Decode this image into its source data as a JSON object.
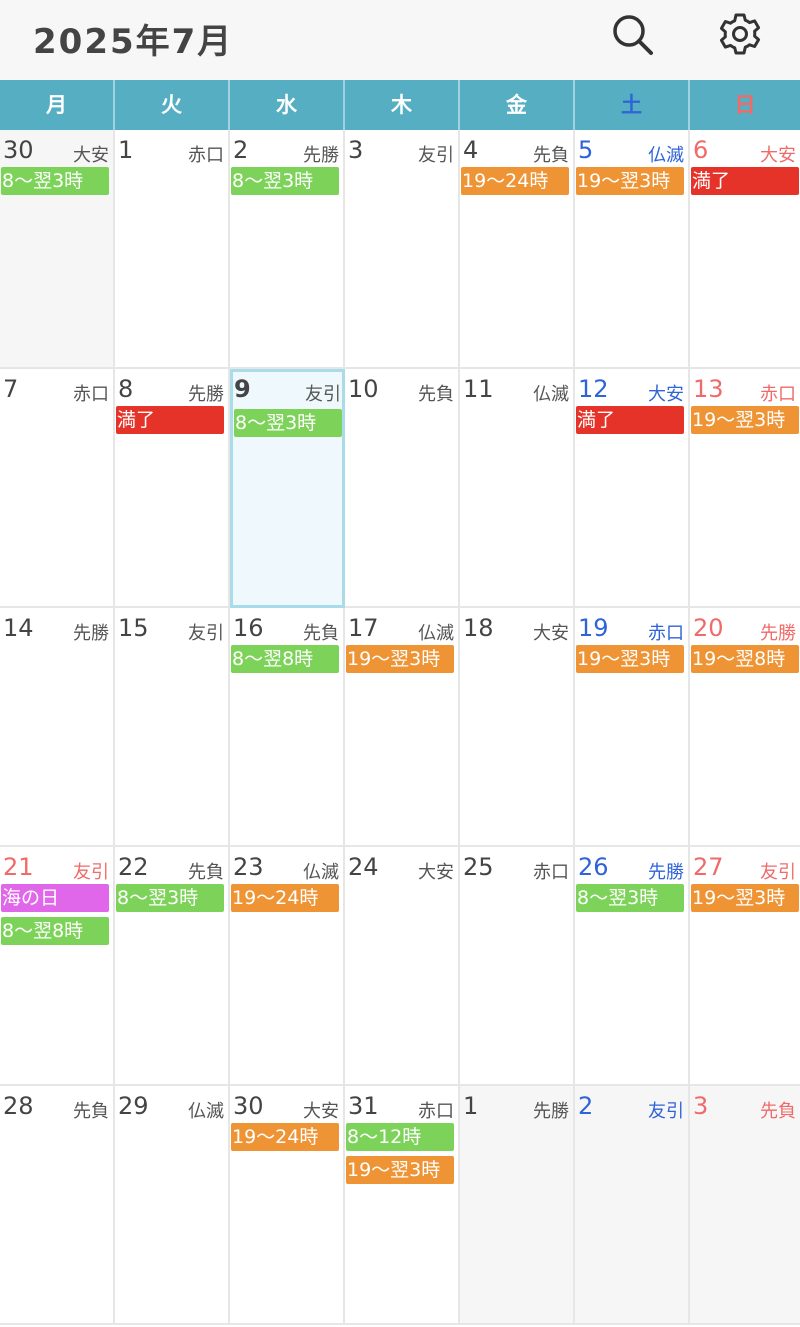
{
  "header": {
    "title": "2025年7月"
  },
  "weekdays": [
    "月",
    "火",
    "水",
    "木",
    "金",
    "土",
    "日"
  ],
  "colors": {
    "header_bg": "#f7f7f7",
    "weekbar": "#56aec3",
    "green": "#7dd35a",
    "orange": "#ee9435",
    "red": "#e63329",
    "magenta": "#e067ea",
    "saturday": "#2f63d8",
    "sunday": "#f06a6a",
    "today_bg": "#eff9fd",
    "other_month_bg": "#f6f6f6"
  },
  "icons": {
    "search": "search-icon",
    "settings": "gear-icon"
  },
  "weeks": [
    [
      {
        "day": "30",
        "rokuyo": "大安",
        "other_month": true,
        "events": [
          {
            "label": "8〜翌3時",
            "color": "green"
          }
        ]
      },
      {
        "day": "1",
        "rokuyo": "赤口",
        "events": []
      },
      {
        "day": "2",
        "rokuyo": "先勝",
        "events": [
          {
            "label": "8〜翌3時",
            "color": "green"
          }
        ]
      },
      {
        "day": "3",
        "rokuyo": "友引",
        "events": []
      },
      {
        "day": "4",
        "rokuyo": "先負",
        "events": [
          {
            "label": "19〜24時",
            "color": "orange"
          }
        ]
      },
      {
        "day": "5",
        "rokuyo": "仏滅",
        "events": [
          {
            "label": "19〜翌3時",
            "color": "orange"
          }
        ]
      },
      {
        "day": "6",
        "rokuyo": "大安",
        "events": [
          {
            "label": "満了",
            "color": "red"
          }
        ]
      }
    ],
    [
      {
        "day": "7",
        "rokuyo": "赤口",
        "events": []
      },
      {
        "day": "8",
        "rokuyo": "先勝",
        "events": [
          {
            "label": "満了",
            "color": "red"
          }
        ]
      },
      {
        "day": "9",
        "rokuyo": "友引",
        "today": true,
        "events": [
          {
            "label": "8〜翌3時",
            "color": "green"
          }
        ]
      },
      {
        "day": "10",
        "rokuyo": "先負",
        "events": []
      },
      {
        "day": "11",
        "rokuyo": "仏滅",
        "events": []
      },
      {
        "day": "12",
        "rokuyo": "大安",
        "events": [
          {
            "label": "満了",
            "color": "red"
          }
        ]
      },
      {
        "day": "13",
        "rokuyo": "赤口",
        "events": [
          {
            "label": "19〜翌3時",
            "color": "orange"
          }
        ]
      }
    ],
    [
      {
        "day": "14",
        "rokuyo": "先勝",
        "events": []
      },
      {
        "day": "15",
        "rokuyo": "友引",
        "events": []
      },
      {
        "day": "16",
        "rokuyo": "先負",
        "events": [
          {
            "label": "8〜翌8時",
            "color": "green"
          }
        ]
      },
      {
        "day": "17",
        "rokuyo": "仏滅",
        "events": [
          {
            "label": "19〜翌3時",
            "color": "orange"
          }
        ]
      },
      {
        "day": "18",
        "rokuyo": "大安",
        "events": []
      },
      {
        "day": "19",
        "rokuyo": "赤口",
        "events": [
          {
            "label": "19〜翌3時",
            "color": "orange"
          }
        ]
      },
      {
        "day": "20",
        "rokuyo": "先勝",
        "events": [
          {
            "label": "19〜翌8時",
            "color": "orange"
          }
        ]
      }
    ],
    [
      {
        "day": "21",
        "rokuyo": "友引",
        "holiday": true,
        "events": [
          {
            "label": "海の日",
            "color": "magenta"
          },
          {
            "label": "8〜翌8時",
            "color": "green"
          }
        ]
      },
      {
        "day": "22",
        "rokuyo": "先負",
        "events": [
          {
            "label": "8〜翌3時",
            "color": "green"
          }
        ]
      },
      {
        "day": "23",
        "rokuyo": "仏滅",
        "events": [
          {
            "label": "19〜24時",
            "color": "orange"
          }
        ]
      },
      {
        "day": "24",
        "rokuyo": "大安",
        "events": []
      },
      {
        "day": "25",
        "rokuyo": "赤口",
        "events": []
      },
      {
        "day": "26",
        "rokuyo": "先勝",
        "events": [
          {
            "label": "8〜翌3時",
            "color": "green"
          }
        ]
      },
      {
        "day": "27",
        "rokuyo": "友引",
        "events": [
          {
            "label": "19〜翌3時",
            "color": "orange"
          }
        ]
      }
    ],
    [
      {
        "day": "28",
        "rokuyo": "先負",
        "events": []
      },
      {
        "day": "29",
        "rokuyo": "仏滅",
        "events": []
      },
      {
        "day": "30",
        "rokuyo": "大安",
        "events": [
          {
            "label": "19〜24時",
            "color": "orange"
          }
        ]
      },
      {
        "day": "31",
        "rokuyo": "赤口",
        "events": [
          {
            "label": "8〜12時",
            "color": "green"
          },
          {
            "label": "19〜翌3時",
            "color": "orange"
          }
        ]
      },
      {
        "day": "1",
        "rokuyo": "先勝",
        "other_month": true,
        "events": []
      },
      {
        "day": "2",
        "rokuyo": "友引",
        "other_month": true,
        "events": []
      },
      {
        "day": "3",
        "rokuyo": "先負",
        "other_month": true,
        "events": []
      }
    ]
  ]
}
